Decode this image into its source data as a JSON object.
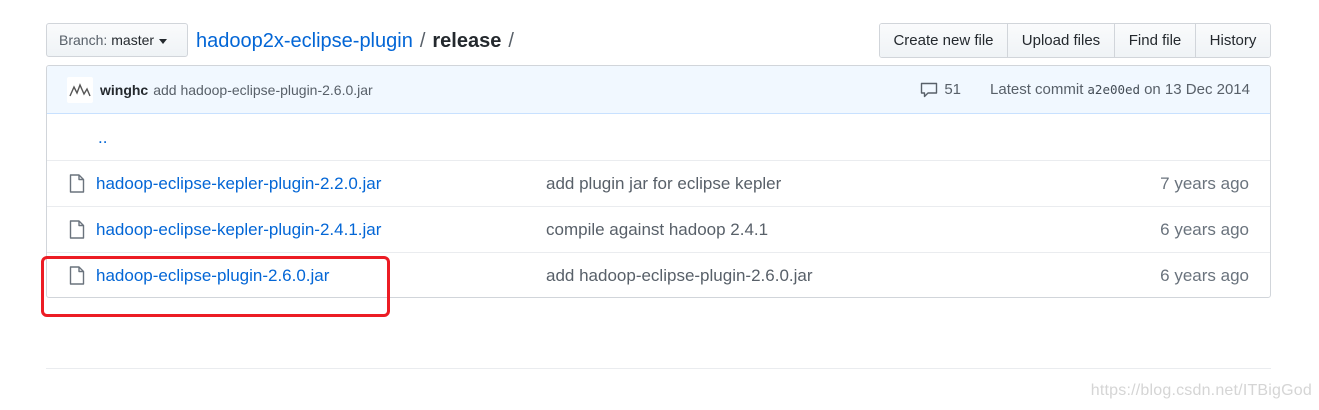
{
  "branch": {
    "prefix": "Branch:",
    "name": "master"
  },
  "breadcrumb": {
    "repo": "hadoop2x-eclipse-plugin",
    "sep1": "/",
    "folder": "release",
    "sep2": "/"
  },
  "actions": [
    "Create new file",
    "Upload files",
    "Find file",
    "History"
  ],
  "commit": {
    "author": "winghc",
    "message": "add hadoop-eclipse-plugin-2.6.0.jar",
    "comments": "51",
    "latest_label": "Latest commit",
    "sha": "a2e00ed",
    "date": "on 13 Dec 2014"
  },
  "parent_dir": "..",
  "files": [
    {
      "name": "hadoop-eclipse-kepler-plugin-2.2.0.jar",
      "message": "add plugin jar for eclipse kepler",
      "age": "7 years ago"
    },
    {
      "name": "hadoop-eclipse-kepler-plugin-2.4.1.jar",
      "message": "compile against hadoop 2.4.1",
      "age": "6 years ago"
    },
    {
      "name": "hadoop-eclipse-plugin-2.6.0.jar",
      "message": "add hadoop-eclipse-plugin-2.6.0.jar",
      "age": "6 years ago"
    }
  ],
  "watermark": "https://blog.csdn.net/ITBigGod",
  "colors": {
    "link": "#0366d6",
    "highlight_box": "#ec1c24",
    "commit_bg": "#f1f8ff"
  },
  "icons": {
    "file": "file-icon",
    "comment": "comment-icon",
    "caret": "caret-down-icon"
  }
}
